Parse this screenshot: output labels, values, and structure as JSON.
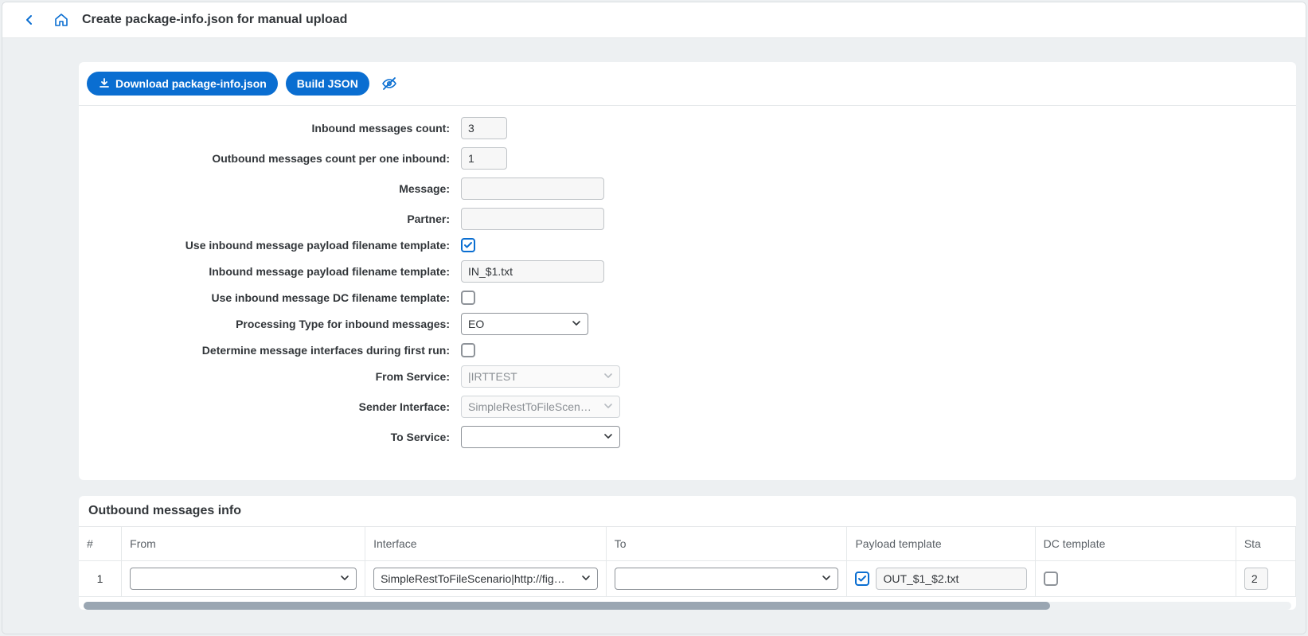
{
  "header": {
    "title": "Create package-info.json for manual upload"
  },
  "toolbar": {
    "download_label": "Download package-info.json",
    "build_label": "Build JSON"
  },
  "form": {
    "inbound_count": {
      "label": "Inbound messages count:",
      "value": "3"
    },
    "outbound_per_inbound": {
      "label": "Outbound messages count per one inbound:",
      "value": "1"
    },
    "message": {
      "label": "Message:",
      "value": ""
    },
    "partner": {
      "label": "Partner:",
      "value": ""
    },
    "use_payload_tpl": {
      "label": "Use inbound message payload filename template:",
      "checked": true
    },
    "payload_tpl": {
      "label": "Inbound message payload filename template:",
      "value": "IN_$1.txt"
    },
    "use_dc_tpl": {
      "label": "Use inbound message DC filename template:",
      "checked": false
    },
    "proc_type": {
      "label": "Processing Type for inbound messages:",
      "value": "EO"
    },
    "determine_first_run": {
      "label": "Determine message interfaces during first run:",
      "checked": false
    },
    "from_service": {
      "label": "From Service:",
      "value": "|IRTTEST"
    },
    "sender_interface": {
      "label": "Sender Interface:",
      "value": "SimpleRestToFileScenar…"
    },
    "to_service": {
      "label": "To Service:",
      "value": ""
    }
  },
  "outbound": {
    "title": "Outbound messages info",
    "columns": {
      "num": "#",
      "from": "From",
      "interface": "Interface",
      "to": "To",
      "payload_template": "Payload template",
      "dc_template": "DC template",
      "status": "Sta"
    },
    "rows": [
      {
        "num": "1",
        "from": "",
        "interface": "SimpleRestToFileScenario|http://fig…",
        "to": "",
        "payload_checked": true,
        "payload_template": "OUT_$1_$2.txt",
        "dc_checked": false,
        "status": "2"
      }
    ]
  }
}
